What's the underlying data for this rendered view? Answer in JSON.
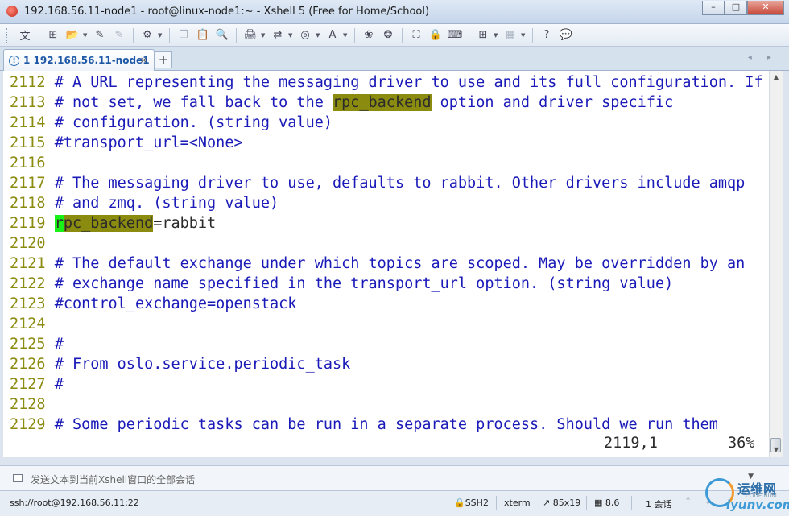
{
  "window": {
    "title": "192.168.56.11-node1 - root@linux-node1:~ - Xshell 5 (Free for Home/School)",
    "buttons": [
      "–",
      "□",
      "✕"
    ]
  },
  "toolbar": {
    "lang_label": "文",
    "icons": [
      {
        "name": "new-session-icon",
        "glyph": "⊞",
        "dropdown": false
      },
      {
        "name": "open-folder-icon",
        "glyph": "📂",
        "dropdown": true
      },
      {
        "name": "reconnect-icon",
        "glyph": "✎",
        "dropdown": false
      },
      {
        "name": "disconnect-icon",
        "glyph": "✎",
        "dropdown": false,
        "disabled": true
      },
      {
        "name": "properties-icon",
        "glyph": "⚙",
        "dropdown": true
      },
      {
        "name": "copy-icon",
        "glyph": "❐",
        "dropdown": false,
        "disabled": true
      },
      {
        "name": "paste-icon",
        "glyph": "📋",
        "dropdown": false
      },
      {
        "name": "find-icon",
        "glyph": "🔍",
        "dropdown": false
      },
      {
        "name": "print-icon",
        "glyph": "🖨",
        "dropdown": true
      },
      {
        "name": "transfer-icon",
        "glyph": "⇄",
        "dropdown": true
      },
      {
        "name": "globe-icon",
        "glyph": "◎",
        "dropdown": true
      },
      {
        "name": "font-icon",
        "glyph": "A",
        "dropdown": true
      },
      {
        "name": "xftp-icon",
        "glyph": "❀",
        "dropdown": false
      },
      {
        "name": "script-icon",
        "glyph": "❂",
        "dropdown": false
      },
      {
        "name": "fullscreen-icon",
        "glyph": "⛶",
        "dropdown": false
      },
      {
        "name": "lock-icon",
        "glyph": "🔒",
        "dropdown": false
      },
      {
        "name": "keyboard-icon",
        "glyph": "⌨",
        "dropdown": false
      },
      {
        "name": "add-icon",
        "glyph": "⊞",
        "dropdown": true
      },
      {
        "name": "layout-icon",
        "glyph": "▦",
        "dropdown": true,
        "disabled": true
      },
      {
        "name": "help-icon",
        "glyph": "?",
        "dropdown": false
      },
      {
        "name": "chat-icon",
        "glyph": "💬",
        "dropdown": false,
        "disabled": true
      }
    ]
  },
  "tabs": [
    {
      "index": "1",
      "label": "1 192.168.56.11-node1",
      "close": "×"
    }
  ],
  "tab_add": "+",
  "tab_nav": "◂ ▸",
  "terminal": {
    "lines": [
      {
        "num": "2112",
        "parts": [
          {
            "text": " # A URL representing the messaging driver to use and its full configuration. If",
            "style": "cm"
          }
        ]
      },
      {
        "num": "2113",
        "parts": [
          {
            "text": " # not set, we fall back to the ",
            "style": "cm"
          },
          {
            "text": "rpc_backend",
            "style": "hl"
          },
          {
            "text": " option and driver specific",
            "style": "cm"
          }
        ]
      },
      {
        "num": "2114",
        "parts": [
          {
            "text": " # configuration. (string value)",
            "style": "cm"
          }
        ]
      },
      {
        "num": "2115",
        "parts": [
          {
            "text": " #transport_url=<None>",
            "style": "cm"
          }
        ]
      },
      {
        "num": "2116",
        "parts": []
      },
      {
        "num": "2117",
        "parts": [
          {
            "text": " # The messaging driver to use, defaults to rabbit. Other drivers include amqp",
            "style": "cm"
          }
        ]
      },
      {
        "num": "2118",
        "parts": [
          {
            "text": " # and zmq. (string value)",
            "style": "cm"
          }
        ]
      },
      {
        "num": "2119",
        "parts": [
          {
            "text": " ",
            "style": "tx"
          },
          {
            "text": "r",
            "style": "cursor"
          },
          {
            "text": "pc_backend",
            "style": "hl"
          },
          {
            "text": "=rabbit",
            "style": "tx"
          }
        ]
      },
      {
        "num": "2120",
        "parts": []
      },
      {
        "num": "2121",
        "parts": [
          {
            "text": " # The default exchange under which topics are scoped. May be overridden by an",
            "style": "cm"
          }
        ]
      },
      {
        "num": "2122",
        "parts": [
          {
            "text": " # exchange name specified in the transport_url option. (string value)",
            "style": "cm"
          }
        ]
      },
      {
        "num": "2123",
        "parts": [
          {
            "text": " #control_exchange=openstack",
            "style": "cm"
          }
        ]
      },
      {
        "num": "2124",
        "parts": []
      },
      {
        "num": "2125",
        "parts": [
          {
            "text": " #",
            "style": "cm"
          }
        ]
      },
      {
        "num": "2126",
        "parts": [
          {
            "text": " # From oslo.service.periodic_task",
            "style": "cm"
          }
        ]
      },
      {
        "num": "2127",
        "parts": [
          {
            "text": " #",
            "style": "cm"
          }
        ]
      },
      {
        "num": "2128",
        "parts": []
      },
      {
        "num": "2129",
        "parts": [
          {
            "text": " # Some periodic tasks can be run in a separate process. Should we run them",
            "style": "cm"
          }
        ]
      }
    ],
    "cursor_position": "2119,1",
    "scroll_percent": "36%",
    "colors": {
      "line_number": "#8b8b10",
      "comment": "#1a1ab8",
      "highlight": "#8b8b10",
      "cursor": "#18f018"
    }
  },
  "scrollbar": {
    "up": "▲",
    "down": "▼"
  },
  "compose": {
    "placeholder": "发送文本到当前Xshell窗口的全部会话",
    "dropdown": "▼"
  },
  "statusbar": {
    "connection": "ssh://root@192.168.56.11:22",
    "protocol": "SSH2",
    "terminal_type": "xterm",
    "size": "85x19",
    "cursor": "8,6",
    "sessions": "1 会话",
    "arrows": "↑ ↓"
  },
  "watermark": {
    "name": "运维网",
    "url": "iyunv.com",
    "sub": "CODE NUM"
  }
}
